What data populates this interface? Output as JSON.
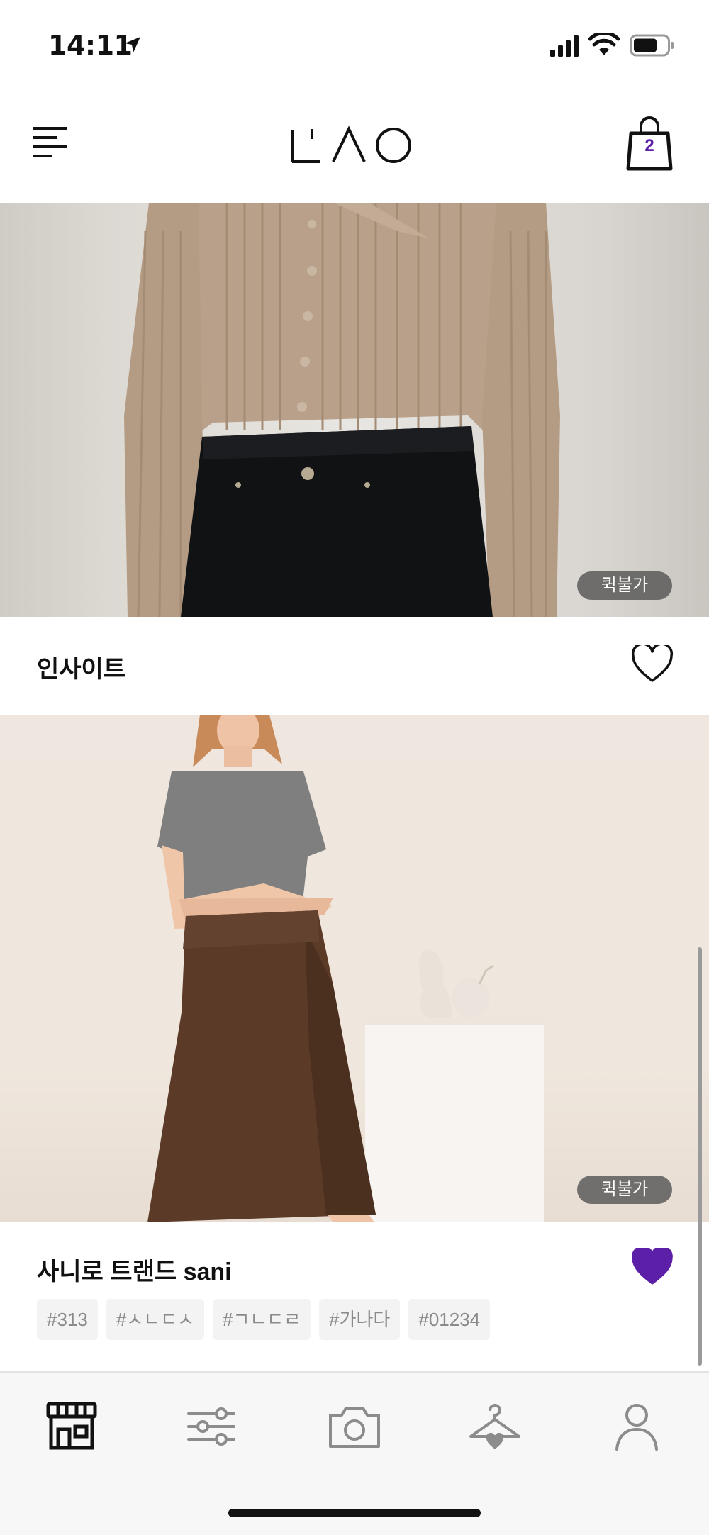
{
  "status_bar": {
    "time": "14:11",
    "icons": [
      "location-arrow-icon",
      "signal-icon",
      "wifi-icon",
      "battery-icon"
    ]
  },
  "header": {
    "logo_icon": "spao-logo",
    "cart_count": "2",
    "icons": [
      "menu-icon",
      "shopping-bag-icon"
    ]
  },
  "products": [
    {
      "name": "인사이트",
      "badge": "퀵불가",
      "liked": false,
      "tags": []
    },
    {
      "name": "사니로 트랜드 sani",
      "badge": "퀵불가",
      "liked": true,
      "tags": [
        "#313",
        "#ㅅㄴㄷㅅ",
        "#ㄱㄴㄷㄹ",
        "#가나다",
        "#01234"
      ]
    }
  ],
  "bottom_nav": {
    "items": [
      "store-icon",
      "filter-sliders-icon",
      "camera-icon",
      "hanger-heart-icon",
      "profile-icon"
    ],
    "active": "store-icon"
  },
  "colors": {
    "accent": "#5b1fa8",
    "badge_bg": "#505050",
    "tag_bg": "#f3f3f3",
    "tag_text": "#8a8a8a"
  }
}
